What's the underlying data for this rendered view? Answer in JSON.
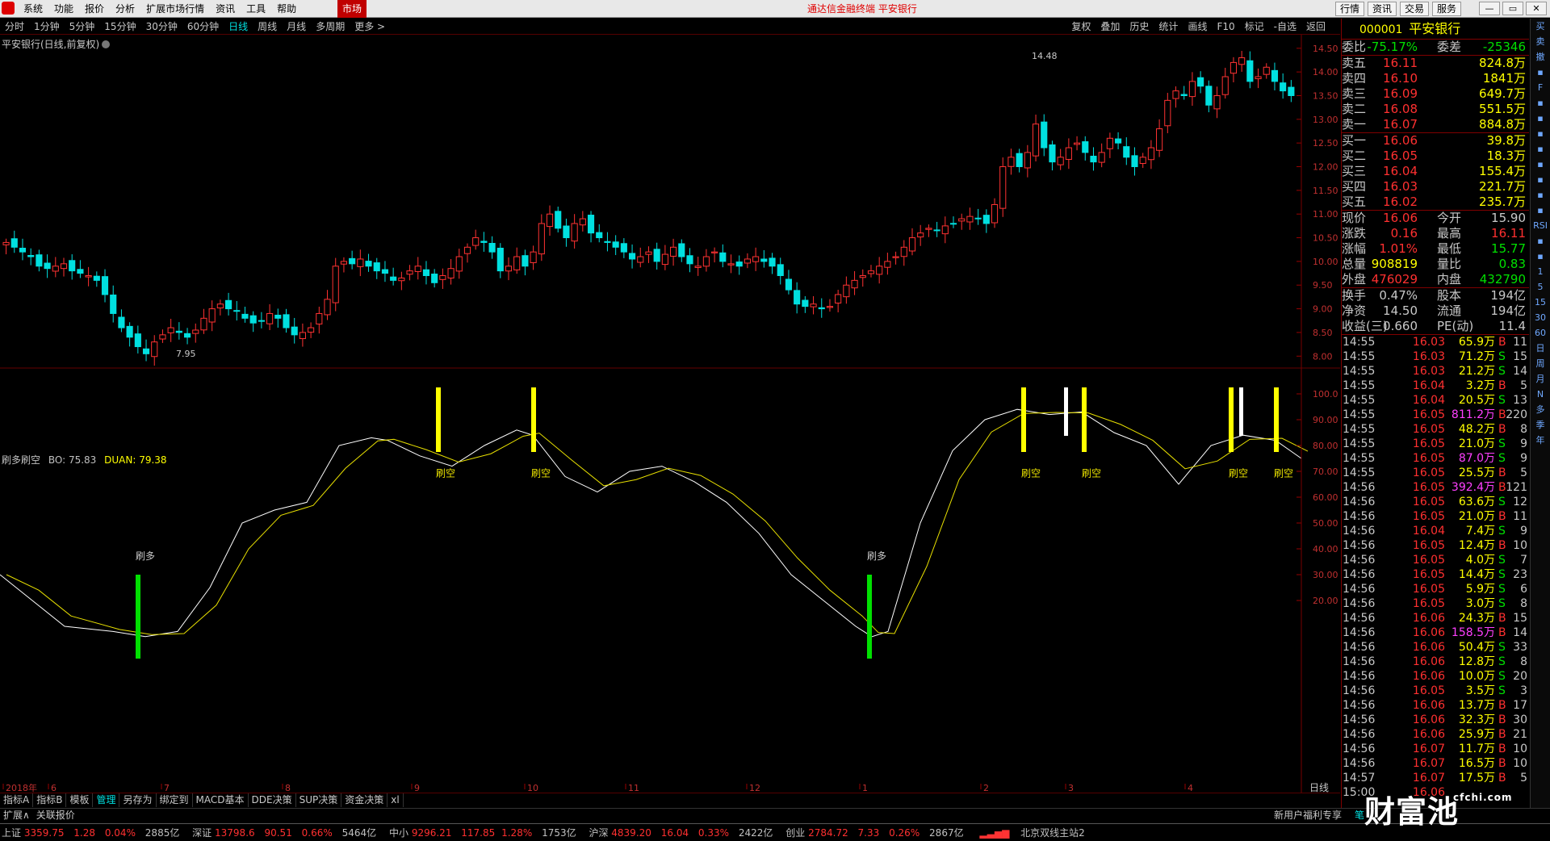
{
  "menu": {
    "items": [
      "系统",
      "功能",
      "报价",
      "分析",
      "扩展市场行情",
      "资讯",
      "工具",
      "帮助"
    ],
    "market_tab": "市场",
    "title": "通达信金融终端  平安银行",
    "right_buttons": [
      "行情",
      "资讯",
      "交易",
      "服务"
    ]
  },
  "periods": [
    "分时",
    "1分钟",
    "5分钟",
    "15分钟",
    "30分钟",
    "60分钟",
    "日线",
    "周线",
    "月线",
    "多周期",
    "更多 >"
  ],
  "active_period": "日线",
  "tools": [
    "复权",
    "叠加",
    "历史",
    "统计",
    "画线",
    "F10",
    "标记",
    "-自选",
    "返回"
  ],
  "stock_title": "平安银行(日线,前复权)",
  "price_axis": [
    "14.50",
    "14.00",
    "13.50",
    "13.00",
    "12.50",
    "12.00",
    "11.50",
    "11.00",
    "10.50",
    "10.00",
    "9.50",
    "9.00",
    "8.50",
    "8.00"
  ],
  "high_label": "14.48",
  "low_label": "7.95",
  "indicator": {
    "name": "刷多刷空",
    "bo": "BO: 75.83",
    "duan": "DUAN: 79.38",
    "axis": [
      "100.0",
      "90.00",
      "80.00",
      "70.00",
      "60.00",
      "50.00",
      "40.00",
      "30.00",
      "20.00"
    ],
    "labels_kong": [
      "刷空",
      "刷空",
      "刷空",
      "刷空",
      "刷空",
      "刷空"
    ],
    "labels_duo": [
      "刷多",
      "刷多"
    ]
  },
  "date_axis": [
    "2018年",
    "6",
    "7",
    "8",
    "9",
    "10",
    "11",
    "12",
    "1",
    "2",
    "3",
    "4"
  ],
  "date_axis_right": "日线",
  "bottom_tabs": [
    "指标A",
    "指标B",
    "模板",
    "管理",
    "另存为",
    "绑定到",
    "MACD基本",
    "DDE决策",
    "SUP决策",
    "资金决策",
    "xl"
  ],
  "bottom_tabs_active": "管理",
  "bottom_tabs2": [
    "扩展∧",
    "关联报价"
  ],
  "bottom_right_tabs": [
    "新用户福利专享",
    "笔"
  ],
  "status": {
    "sh": {
      "name": "上证",
      "price": "3359.75",
      "chg": "1.28",
      "pct": "0.04%",
      "amt": "2885亿"
    },
    "sz": {
      "name": "深证",
      "price": "13798.6",
      "chg": "90.51",
      "pct": "0.66%",
      "amt": "5464亿"
    },
    "zx": {
      "name": "中小",
      "price": "9296.21",
      "chg": "117.85",
      "pct": "1.28%",
      "amt": "1753亿"
    },
    "hs": {
      "name": "沪深",
      "price": "4839.20",
      "chg": "16.04",
      "pct": "0.33%",
      "amt": "2422亿"
    },
    "cy": {
      "name": "创业",
      "price": "2784.72",
      "chg": "7.33",
      "pct": "0.26%",
      "amt": "2867亿"
    },
    "server": "北京双线主站2"
  },
  "quote": {
    "code": "000001",
    "name": "平安银行",
    "weibi_label": "委比",
    "weibi": "-75.17%",
    "weicha_label": "委差",
    "weicha": "-25346",
    "asks": [
      {
        "label": "卖五",
        "price": "16.11",
        "vol": "824.8万"
      },
      {
        "label": "卖四",
        "price": "16.10",
        "vol": "1841万"
      },
      {
        "label": "卖三",
        "price": "16.09",
        "vol": "649.7万"
      },
      {
        "label": "卖二",
        "price": "16.08",
        "vol": "551.5万"
      },
      {
        "label": "卖一",
        "price": "16.07",
        "vol": "884.8万"
      }
    ],
    "bids": [
      {
        "label": "买一",
        "price": "16.06",
        "vol": "39.8万"
      },
      {
        "label": "买二",
        "price": "16.05",
        "vol": "18.3万"
      },
      {
        "label": "买三",
        "price": "16.04",
        "vol": "155.4万"
      },
      {
        "label": "买四",
        "price": "16.03",
        "vol": "221.7万"
      },
      {
        "label": "买五",
        "price": "16.02",
        "vol": "235.7万"
      }
    ],
    "stats": [
      {
        "l1": "现价",
        "v1": "16.06",
        "c1": "r",
        "l2": "今开",
        "v2": "15.90",
        "c2": "w"
      },
      {
        "l1": "涨跌",
        "v1": "0.16",
        "c1": "r",
        "l2": "最高",
        "v2": "16.11",
        "c2": "r"
      },
      {
        "l1": "涨幅",
        "v1": "1.01%",
        "c1": "r",
        "l2": "最低",
        "v2": "15.77",
        "c2": "g"
      },
      {
        "l1": "总量",
        "v1": "908819",
        "c1": "y",
        "l2": "量比",
        "v2": "0.83",
        "c2": "g"
      },
      {
        "l1": "外盘",
        "v1": "476029",
        "c1": "r",
        "l2": "内盘",
        "v2": "432790",
        "c2": "g"
      }
    ],
    "stats2": [
      {
        "l1": "换手",
        "v1": "0.47%",
        "l2": "股本",
        "v2": "194亿"
      },
      {
        "l1": "净资",
        "v1": "14.50",
        "l2": "流通",
        "v2": "194亿"
      },
      {
        "l1": "收益(三)",
        "v1": "0.660",
        "l2": "PE(动)",
        "v2": "11.4"
      }
    ],
    "ticks": [
      {
        "t": "14:55",
        "p": "16.03",
        "v": "65.9万",
        "bs": "B",
        "n": "11"
      },
      {
        "t": "14:55",
        "p": "16.03",
        "v": "71.2万",
        "bs": "S",
        "n": "15"
      },
      {
        "t": "14:55",
        "p": "16.03",
        "v": "21.2万",
        "bs": "S",
        "n": "14"
      },
      {
        "t": "14:55",
        "p": "16.04",
        "v": "3.2万",
        "bs": "B",
        "n": "5"
      },
      {
        "t": "14:55",
        "p": "16.04",
        "v": "20.5万",
        "bs": "S",
        "n": "13"
      },
      {
        "t": "14:55",
        "p": "16.05",
        "v": "811.2万",
        "bs": "B",
        "n": "220"
      },
      {
        "t": "14:55",
        "p": "16.05",
        "v": "48.2万",
        "bs": "B",
        "n": "8"
      },
      {
        "t": "14:55",
        "p": "16.05",
        "v": "21.0万",
        "bs": "S",
        "n": "9"
      },
      {
        "t": "14:55",
        "p": "16.05",
        "v": "87.0万",
        "bs": "S",
        "n": "9"
      },
      {
        "t": "14:55",
        "p": "16.05",
        "v": "25.5万",
        "bs": "B",
        "n": "5"
      },
      {
        "t": "14:56",
        "p": "16.05",
        "v": "392.4万",
        "bs": "B",
        "n": "121"
      },
      {
        "t": "14:56",
        "p": "16.05",
        "v": "63.6万",
        "bs": "S",
        "n": "12"
      },
      {
        "t": "14:56",
        "p": "16.05",
        "v": "21.0万",
        "bs": "B",
        "n": "11"
      },
      {
        "t": "14:56",
        "p": "16.04",
        "v": "7.4万",
        "bs": "S",
        "n": "9"
      },
      {
        "t": "14:56",
        "p": "16.05",
        "v": "12.4万",
        "bs": "B",
        "n": "10"
      },
      {
        "t": "14:56",
        "p": "16.05",
        "v": "4.0万",
        "bs": "S",
        "n": "7"
      },
      {
        "t": "14:56",
        "p": "16.05",
        "v": "14.4万",
        "bs": "S",
        "n": "23"
      },
      {
        "t": "14:56",
        "p": "16.05",
        "v": "5.9万",
        "bs": "S",
        "n": "6"
      },
      {
        "t": "14:56",
        "p": "16.05",
        "v": "3.0万",
        "bs": "S",
        "n": "8"
      },
      {
        "t": "14:56",
        "p": "16.06",
        "v": "24.3万",
        "bs": "B",
        "n": "15"
      },
      {
        "t": "14:56",
        "p": "16.06",
        "v": "158.5万",
        "bs": "B",
        "n": "14"
      },
      {
        "t": "14:56",
        "p": "16.06",
        "v": "50.4万",
        "bs": "S",
        "n": "33"
      },
      {
        "t": "14:56",
        "p": "16.06",
        "v": "12.8万",
        "bs": "S",
        "n": "8"
      },
      {
        "t": "14:56",
        "p": "16.06",
        "v": "10.0万",
        "bs": "S",
        "n": "20"
      },
      {
        "t": "14:56",
        "p": "16.05",
        "v": "3.5万",
        "bs": "S",
        "n": "3"
      },
      {
        "t": "14:56",
        "p": "16.06",
        "v": "13.7万",
        "bs": "B",
        "n": "17"
      },
      {
        "t": "14:56",
        "p": "16.06",
        "v": "32.3万",
        "bs": "B",
        "n": "30"
      },
      {
        "t": "14:56",
        "p": "16.06",
        "v": "25.9万",
        "bs": "B",
        "n": "21"
      },
      {
        "t": "14:56",
        "p": "16.07",
        "v": "11.7万",
        "bs": "B",
        "n": "10"
      },
      {
        "t": "14:56",
        "p": "16.07",
        "v": "16.5万",
        "bs": "B",
        "n": "10"
      },
      {
        "t": "14:57",
        "p": "16.07",
        "v": "17.5万",
        "bs": "B",
        "n": "5"
      },
      {
        "t": "15:00",
        "p": "16.06",
        "v": "",
        "bs": "",
        "n": ""
      }
    ]
  },
  "side_tools": [
    "买",
    "卖",
    "撤",
    "",
    "F",
    "",
    "",
    "",
    "",
    "",
    "",
    "",
    "",
    "RSI",
    "",
    "",
    "1",
    "5",
    "15",
    "30",
    "60",
    "日",
    "周",
    "月",
    "N",
    "多",
    "季",
    "年"
  ],
  "watermark": "财富池",
  "watermark_small": "cfchi.com",
  "colors": {
    "up": "#ff3232",
    "down": "#00e0e0",
    "ma_white": "#ffffff",
    "ma_yellow": "#e8e000",
    "bar_yellow": "#ffff00",
    "bar_green": "#00e000"
  }
}
